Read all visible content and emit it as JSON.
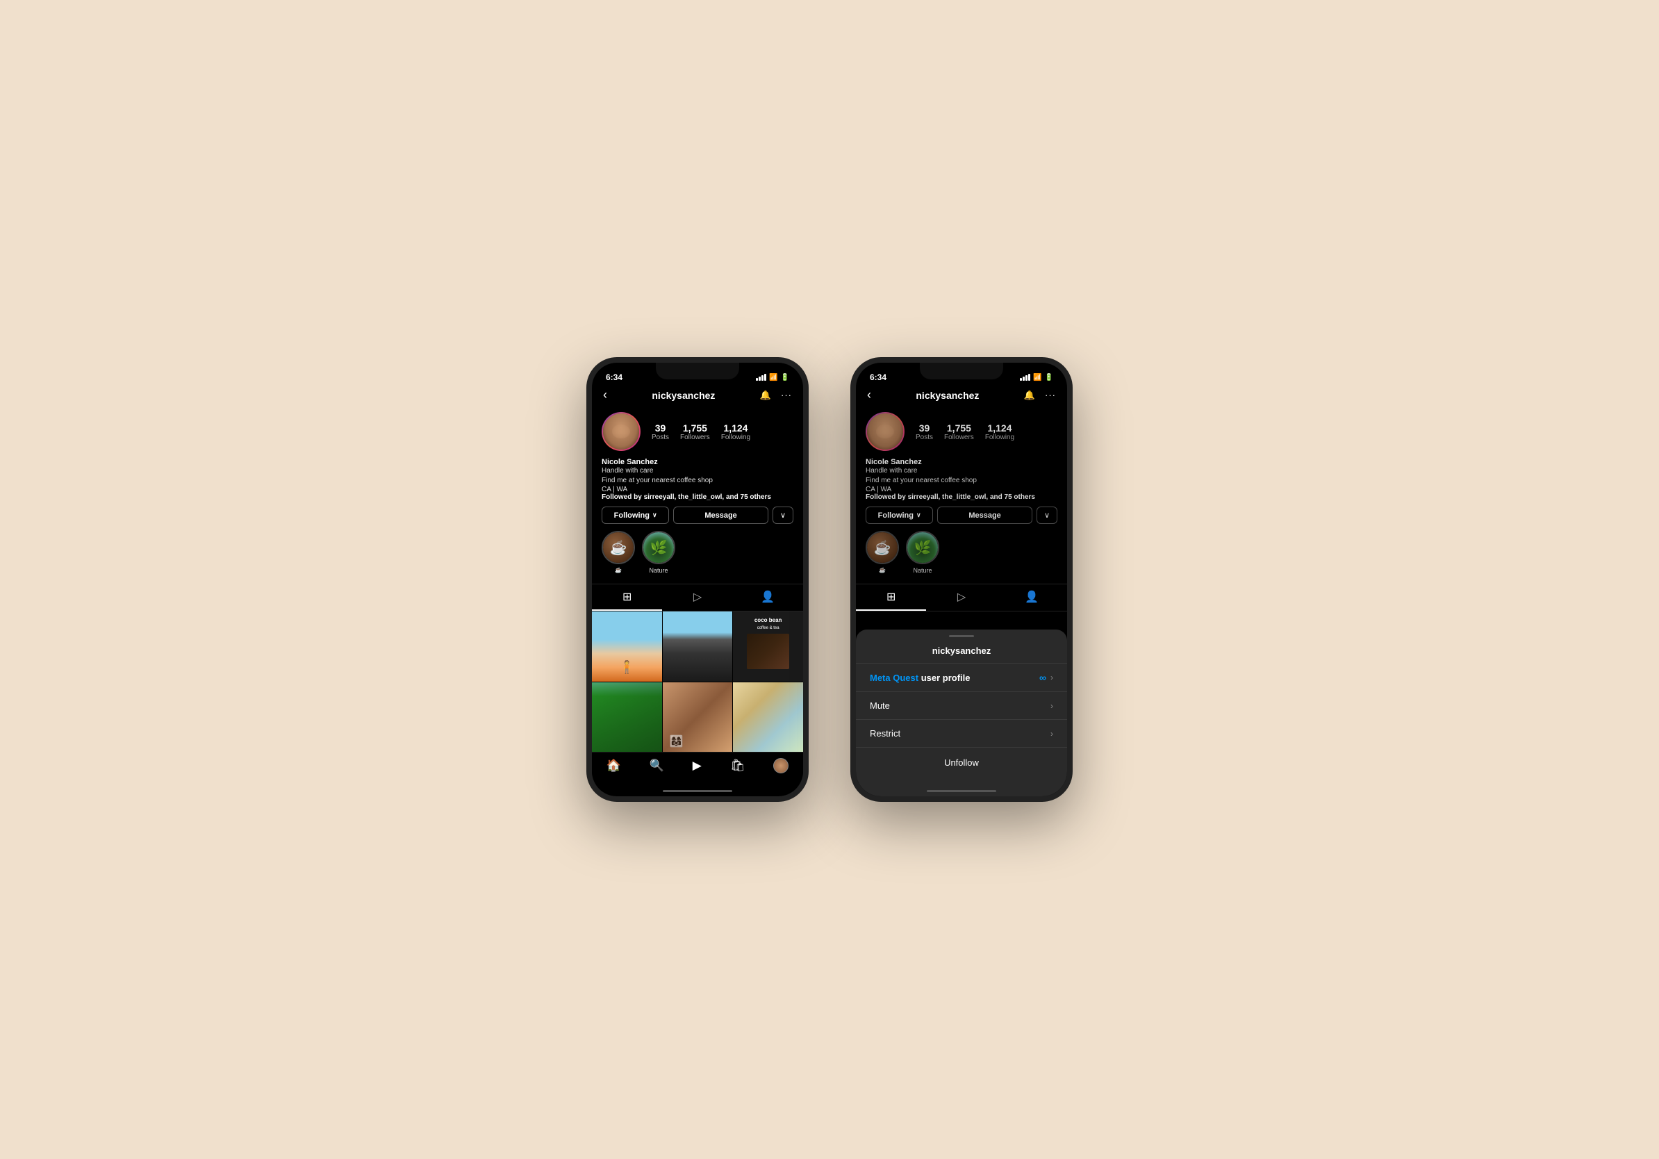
{
  "background": "#f0e0cc",
  "phone1": {
    "status_bar": {
      "time": "6:34",
      "signal": "▲",
      "wifi": "wifi",
      "battery": "battery"
    },
    "nav": {
      "back": "‹",
      "username": "nickysanchez",
      "bell": "🔔",
      "more": "···"
    },
    "profile": {
      "stats": [
        {
          "number": "39",
          "label": "Posts"
        },
        {
          "number": "1,755",
          "label": "Followers"
        },
        {
          "number": "1,124",
          "label": "Following"
        }
      ],
      "name": "Nicole Sanchez",
      "bio_line1": "Handle with care",
      "bio_line2": "Find me at your nearest coffee shop",
      "location": "CA | WA",
      "followed_by": "Followed by ",
      "followed_by_names": "sirreeyall, the_little_owl,",
      "followed_by_suffix": " and 75 others"
    },
    "buttons": {
      "following": "Following",
      "following_chevron": "∨",
      "message": "Message",
      "more": "∨"
    },
    "highlights": [
      {
        "label": ""
      },
      {
        "label": "Nature"
      }
    ],
    "tabs": [
      "⊞",
      "▷",
      "👤"
    ],
    "bottom_nav": [
      "🏠",
      "🔍",
      "▶",
      "🛍",
      "👤"
    ]
  },
  "phone2": {
    "status_bar": {
      "time": "6:34"
    },
    "nav": {
      "back": "‹",
      "username": "nickysanchez"
    },
    "modal": {
      "username": "nickysanchez",
      "items": [
        {
          "label_prefix": "Meta Quest",
          "label_suffix": " user profile",
          "has_meta_logo": true,
          "has_chevron": true,
          "is_meta": true
        },
        {
          "label": "Mute",
          "has_chevron": true,
          "is_meta": false
        },
        {
          "label": "Restrict",
          "has_chevron": true,
          "is_meta": false
        },
        {
          "label": "Unfollow",
          "has_chevron": false,
          "is_meta": false,
          "is_unfollow": true
        }
      ]
    }
  }
}
